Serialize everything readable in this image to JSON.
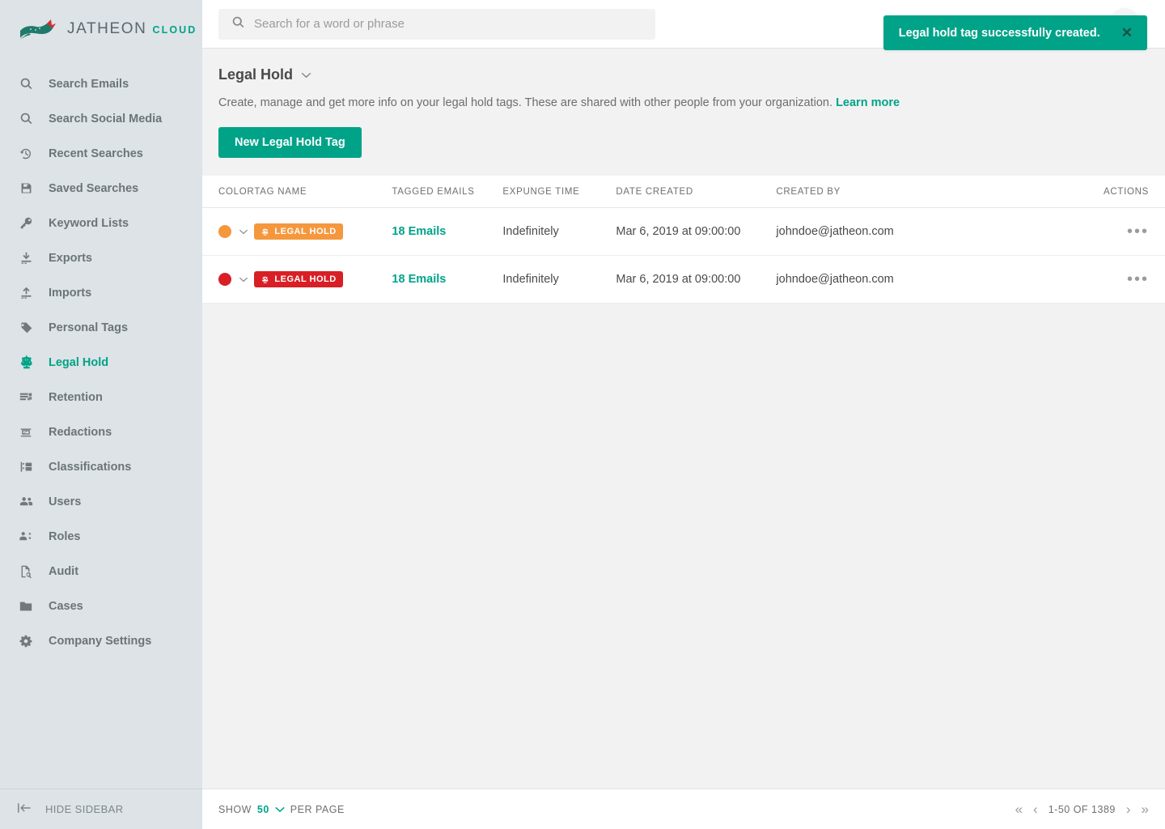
{
  "brand": {
    "name": "JATHEON",
    "suffix": "CLOUD",
    "accent": "#00a388",
    "logo_icon": "fox-logo-icon"
  },
  "sidebar": {
    "items": [
      {
        "label": "Search Emails",
        "icon": "search-icon",
        "active": false
      },
      {
        "label": "Search Social Media",
        "icon": "search-icon",
        "active": false
      },
      {
        "label": "Recent Searches",
        "icon": "history-icon",
        "active": false
      },
      {
        "label": "Saved Searches",
        "icon": "save-icon",
        "active": false
      },
      {
        "label": "Keyword Lists",
        "icon": "key-icon",
        "active": false
      },
      {
        "label": "Exports",
        "icon": "download-icon",
        "active": false
      },
      {
        "label": "Imports",
        "icon": "upload-icon",
        "active": false
      },
      {
        "label": "Personal Tags",
        "icon": "tag-icon",
        "active": false
      },
      {
        "label": "Legal Hold",
        "icon": "scales-icon",
        "active": true
      },
      {
        "label": "Retention",
        "icon": "retention-icon",
        "active": false
      },
      {
        "label": "Redactions",
        "icon": "redaction-icon",
        "active": false
      },
      {
        "label": "Classifications",
        "icon": "classification-icon",
        "active": false
      },
      {
        "label": "Users",
        "icon": "users-icon",
        "active": false
      },
      {
        "label": "Roles",
        "icon": "roles-icon",
        "active": false
      },
      {
        "label": "Audit",
        "icon": "audit-icon",
        "active": false
      },
      {
        "label": "Cases",
        "icon": "folder-icon",
        "active": false
      },
      {
        "label": "Company Settings",
        "icon": "gear-icon",
        "active": false
      }
    ],
    "hide_sidebar_label": "HIDE SIDEBAR",
    "hide_sidebar_icon": "collapse-left-icon"
  },
  "search": {
    "placeholder": "Search for a word or phrase",
    "value": "",
    "icon": "search-icon"
  },
  "toast": {
    "message": "Legal hold tag successfully created.",
    "close_icon": "close-icon",
    "color": "#00a388"
  },
  "page": {
    "title": "Legal Hold",
    "title_chevron_icon": "chevron-down-icon",
    "description": "Create, manage and get more info on your legal hold tags. These are shared with other people from your organization.",
    "learn_more_label": "Learn more",
    "new_tag_button": "New Legal Hold Tag"
  },
  "table": {
    "columns": [
      "COLOR",
      "TAG NAME",
      "TAGGED EMAILS",
      "EXPUNGE TIME",
      "DATE CREATED",
      "CREATED BY",
      "ACTIONS"
    ],
    "rows": [
      {
        "color": "#f5973d",
        "tag_name": "LEGAL HOLD",
        "tagged_emails": "18 Emails",
        "expunge_time": "Indefinitely",
        "date_created": "Mar 6, 2019 at 09:00:00",
        "created_by": "johndoe@jatheon.com",
        "actions": "•••"
      },
      {
        "color": "#d81f26",
        "tag_name": "LEGAL HOLD",
        "tagged_emails": "18 Emails",
        "expunge_time": "Indefinitely",
        "date_created": "Mar 6, 2019 at 09:00:00",
        "created_by": "johndoe@jatheon.com",
        "actions": "•••"
      }
    ]
  },
  "footer": {
    "show_label": "SHOW",
    "per_page_value": "50",
    "per_page_label": "PER PAGE",
    "per_page_chevron_icon": "chevron-down-icon",
    "pagination": {
      "first_icon": "«",
      "prev_icon": "‹",
      "range": "1-50 OF 1389",
      "next_icon": "›",
      "last_icon": "»"
    }
  }
}
